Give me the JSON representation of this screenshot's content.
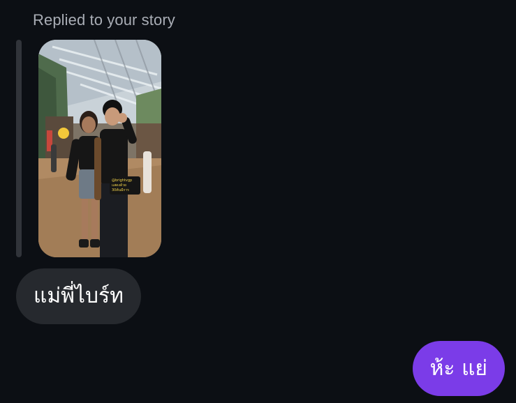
{
  "thread": {
    "reply_caption": "Replied to your story",
    "story_sticker_text": "@brightvgp\nแสดงด้วย\n30ต้นมีการ"
  },
  "messages": [
    {
      "direction": "incoming",
      "text": "แม่พี่ไบร์ท"
    },
    {
      "direction": "outgoing",
      "text": "ห้ะ แย่"
    }
  ],
  "colors": {
    "background": "#0c0f14",
    "incoming_bubble": "#26292e",
    "outgoing_bubble": "#7b3ce8",
    "caption_text": "#a9adb5",
    "quote_bar": "#31343a"
  }
}
